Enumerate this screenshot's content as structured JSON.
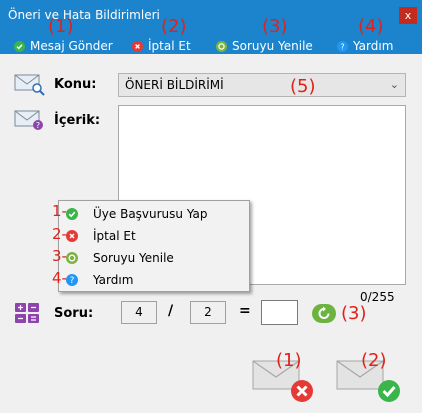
{
  "window": {
    "title": "Öneri ve Hata Bildirimleri",
    "close_glyph": "x"
  },
  "toolbar": [
    {
      "label": "Mesaj Gönder",
      "icon": "check-icon",
      "color": "#39b54a"
    },
    {
      "label": "İptal Et",
      "icon": "cancel-icon",
      "color": "#e53935"
    },
    {
      "label": "Soruyu Yenile",
      "icon": "refresh-icon",
      "color": "#7cb342"
    },
    {
      "label": "Yardım",
      "icon": "help-icon",
      "color": "#2196f3"
    }
  ],
  "annotations": {
    "toolbar": [
      "(1)",
      "(2)",
      "(3)",
      "(4)"
    ],
    "subject": "(5)",
    "menu": [
      "1-",
      "2-",
      "3-",
      "4-"
    ],
    "refresh": "(3)",
    "bottom": [
      "(1)",
      "(2)"
    ]
  },
  "form": {
    "subject_label": "Konu:",
    "subject_value": "ÖNERİ BİLDİRİMİ",
    "content_label": "İçerik:",
    "char_count": "0/255"
  },
  "context_menu": [
    {
      "label": "Üye Başvurusu Yap",
      "icon": "check-icon",
      "color": "#39b54a"
    },
    {
      "label": "İptal Et",
      "icon": "cancel-icon",
      "color": "#e53935"
    },
    {
      "label": "Soruyu Yenile",
      "icon": "refresh-icon",
      "color": "#7cb342"
    },
    {
      "label": "Yardım",
      "icon": "help-icon",
      "color": "#2196f3"
    }
  ],
  "captcha": {
    "label": "Soru:",
    "first": "4",
    "operator": "/",
    "second": "2",
    "equals": "=",
    "answer": ""
  },
  "bottom_buttons": [
    {
      "name": "cancel-send",
      "icon": "envelope-cancel-icon",
      "badge_color": "#e53935"
    },
    {
      "name": "send",
      "icon": "envelope-check-icon",
      "badge_color": "#39b54a"
    }
  ]
}
